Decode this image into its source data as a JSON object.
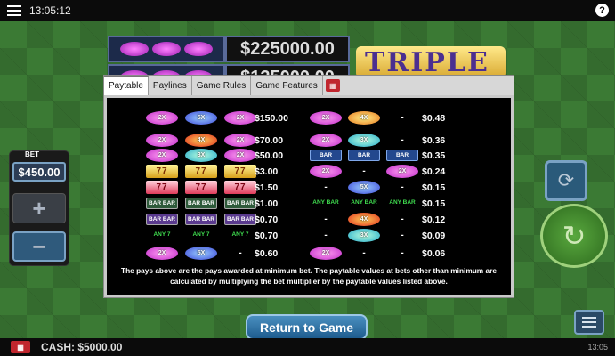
{
  "top_bar": {
    "clock": "13:05:12",
    "help_label": "?"
  },
  "jackpots": [
    {
      "symbol_label": "2X 5X 2X",
      "value": "$225000.00"
    },
    {
      "symbol_label": "2X 2X 2X",
      "value": "$125000.00"
    }
  ],
  "logo": {
    "text": "TRIPLE"
  },
  "bet_panel": {
    "label": "BET",
    "value": "$450.00",
    "plus": "+",
    "minus": "−"
  },
  "paytable": {
    "tabs": [
      "Paytable",
      "Paylines",
      "Game Rules",
      "Game Features"
    ],
    "active_tab": "Paytable",
    "left_rows": [
      {
        "symbols": [
          {
            "type": "pill",
            "color": "pink",
            "label": "2X"
          },
          {
            "type": "pill",
            "color": "blue",
            "label": "5X"
          },
          {
            "type": "pill",
            "color": "pink",
            "label": "2X"
          }
        ],
        "pay": "$150.00"
      },
      {
        "symbols": [
          {
            "type": "pill",
            "color": "pink",
            "label": "2X"
          },
          {
            "type": "pill",
            "color": "red",
            "label": "4X"
          },
          {
            "type": "pill",
            "color": "pink",
            "label": "2X"
          }
        ],
        "pay": "$70.00"
      },
      {
        "symbols": [
          {
            "type": "pill",
            "color": "pink",
            "label": "2X"
          },
          {
            "type": "pill",
            "color": "teal",
            "label": "3X"
          },
          {
            "type": "pill",
            "color": "pink",
            "label": "2X"
          }
        ],
        "pay": "$50.00"
      },
      {
        "symbols": [
          {
            "type": "seven",
            "color": "yellow",
            "label": "77"
          },
          {
            "type": "seven",
            "color": "yellow",
            "label": "77"
          },
          {
            "type": "seven",
            "color": "yellow",
            "label": "77"
          }
        ],
        "pay": "$3.00"
      },
      {
        "symbols": [
          {
            "type": "seven",
            "color": "red",
            "label": "77"
          },
          {
            "type": "seven",
            "color": "red",
            "label": "77"
          },
          {
            "type": "seven",
            "color": "red",
            "label": "77"
          }
        ],
        "pay": "$1.50"
      },
      {
        "symbols": [
          {
            "type": "bar",
            "color": "green",
            "label": "BAR BAR"
          },
          {
            "type": "bar",
            "color": "green",
            "label": "BAR BAR"
          },
          {
            "type": "bar",
            "color": "green",
            "label": "BAR BAR"
          }
        ],
        "pay": "$1.00"
      },
      {
        "symbols": [
          {
            "type": "bar",
            "color": "purple",
            "label": "BAR BAR"
          },
          {
            "type": "bar",
            "color": "purple",
            "label": "BAR BAR"
          },
          {
            "type": "bar",
            "color": "purple",
            "label": "BAR BAR"
          }
        ],
        "pay": "$0.70"
      },
      {
        "symbols": [
          {
            "type": "text",
            "label": "ANY 7"
          },
          {
            "type": "text",
            "label": "ANY 7"
          },
          {
            "type": "text",
            "label": "ANY 7"
          }
        ],
        "pay": "$0.70"
      },
      {
        "symbols": [
          {
            "type": "pill",
            "color": "pink",
            "label": "2X"
          },
          {
            "type": "pill",
            "color": "blue",
            "label": "5X"
          },
          {
            "type": "dash",
            "label": "-"
          }
        ],
        "pay": "$0.60"
      }
    ],
    "right_rows": [
      {
        "symbols": [
          {
            "type": "pill",
            "color": "pink",
            "label": "2X"
          },
          {
            "type": "pill",
            "color": "orange",
            "label": "4X"
          },
          {
            "type": "dash",
            "label": "-"
          }
        ],
        "pay": "$0.48"
      },
      {
        "symbols": [
          {
            "type": "pill",
            "color": "pink",
            "label": "2X"
          },
          {
            "type": "pill",
            "color": "teal",
            "label": "3X"
          },
          {
            "type": "dash",
            "label": "-"
          }
        ],
        "pay": "$0.36"
      },
      {
        "symbols": [
          {
            "type": "bar",
            "color": "blue",
            "label": "BAR"
          },
          {
            "type": "bar",
            "color": "blue",
            "label": "BAR"
          },
          {
            "type": "bar",
            "color": "blue",
            "label": "BAR"
          }
        ],
        "pay": "$0.35"
      },
      {
        "symbols": [
          {
            "type": "pill",
            "color": "pink",
            "label": "2X"
          },
          {
            "type": "dash",
            "label": "-"
          },
          {
            "type": "pill",
            "color": "pink",
            "label": "2X"
          }
        ],
        "pay": "$0.24"
      },
      {
        "symbols": [
          {
            "type": "dash",
            "label": "-"
          },
          {
            "type": "pill",
            "color": "blue",
            "label": "5X"
          },
          {
            "type": "dash",
            "label": "-"
          }
        ],
        "pay": "$0.15"
      },
      {
        "symbols": [
          {
            "type": "text",
            "label": "ANY BAR"
          },
          {
            "type": "text",
            "label": "ANY BAR"
          },
          {
            "type": "text",
            "label": "ANY BAR"
          }
        ],
        "pay": "$0.15"
      },
      {
        "symbols": [
          {
            "type": "dash",
            "label": "-"
          },
          {
            "type": "pill",
            "color": "red",
            "label": "4X"
          },
          {
            "type": "dash",
            "label": "-"
          }
        ],
        "pay": "$0.12"
      },
      {
        "symbols": [
          {
            "type": "dash",
            "label": "-"
          },
          {
            "type": "pill",
            "color": "teal",
            "label": "3X"
          },
          {
            "type": "dash",
            "label": "-"
          }
        ],
        "pay": "$0.09"
      },
      {
        "symbols": [
          {
            "type": "pill",
            "color": "pink",
            "label": "2X"
          },
          {
            "type": "dash",
            "label": "-"
          },
          {
            "type": "dash",
            "label": "-"
          }
        ],
        "pay": "$0.06"
      }
    ],
    "footnote": "The pays above are the pays awarded at minimum bet. The paytable values at bets other than minimum are calculated by multiplying the bet multiplier by the paytable values listed above."
  },
  "return_button": {
    "label": "Return to Game"
  },
  "bottom_bar": {
    "cash": "CASH: $5000.00",
    "clock": "13:05"
  }
}
